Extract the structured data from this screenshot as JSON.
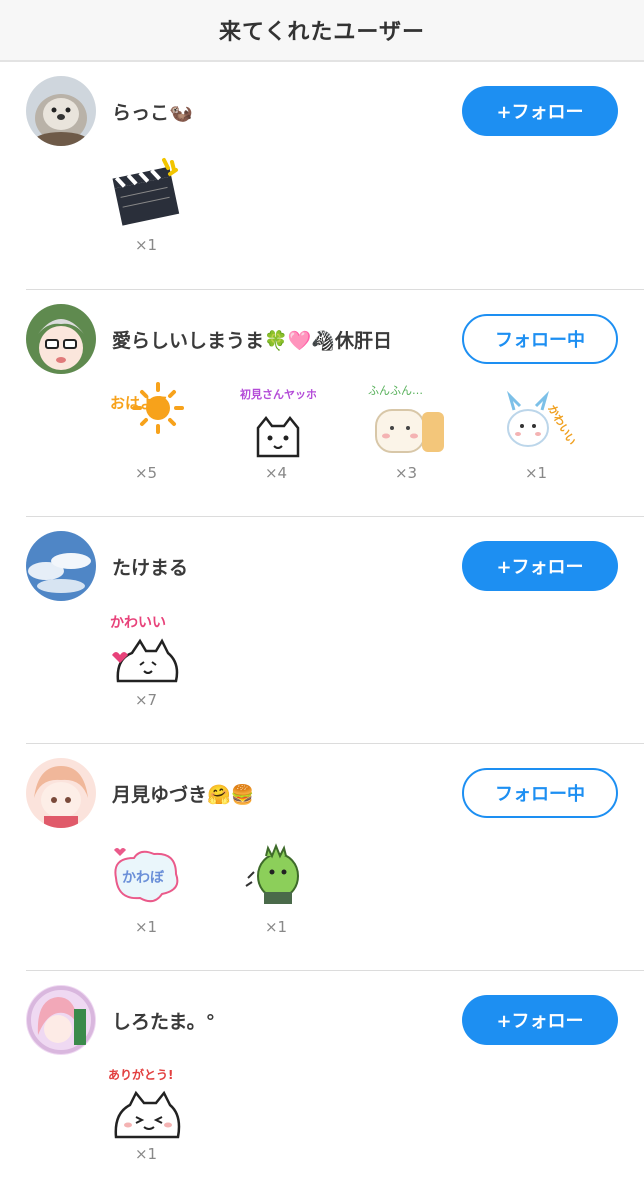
{
  "header": {
    "title": "来てくれたユーザー"
  },
  "users": [
    {
      "name": "らっこ🦦",
      "button": "+フォロー",
      "stamps": [
        {
          "icon": "clapperboard-stamp",
          "count": "×1"
        }
      ]
    },
    {
      "name": "愛らしいしまうま🍀🩷🦓休肝日",
      "button": "フォロー中",
      "stamps": [
        {
          "icon": "ohayou-sun-stamp",
          "text": "おはよう",
          "count": "×5"
        },
        {
          "icon": "hatsumi-cat-stamp",
          "text": "初見さんヤッホー",
          "count": "×4"
        },
        {
          "icon": "funfun-cat-stamp",
          "text": "ふんふん…",
          "count": "×3"
        },
        {
          "icon": "kawaii-dragon-stamp",
          "text": "かわいい",
          "count": "×1"
        }
      ]
    },
    {
      "name": "たけまる",
      "button": "+フォロー",
      "stamps": [
        {
          "icon": "kawaii-cat-stamp",
          "text": "かわいい",
          "count": "×7"
        }
      ]
    },
    {
      "name": "月見ゆづき🤗🍔",
      "button": "フォロー中",
      "stamps": [
        {
          "icon": "kawabo-bubble-stamp",
          "text": "かわぼ",
          "count": "×1"
        },
        {
          "icon": "green-monster-stamp",
          "count": "×1"
        }
      ]
    },
    {
      "name": "しろたま。°",
      "button": "+フォロー",
      "stamps": [
        {
          "icon": "arigatou-cat-stamp",
          "text": "ありがとう!",
          "count": "×1"
        }
      ]
    }
  ],
  "colors": {
    "accent": "#1d8ff2",
    "header_bg": "#f7f7f7",
    "divider": "#dcdcdc"
  }
}
